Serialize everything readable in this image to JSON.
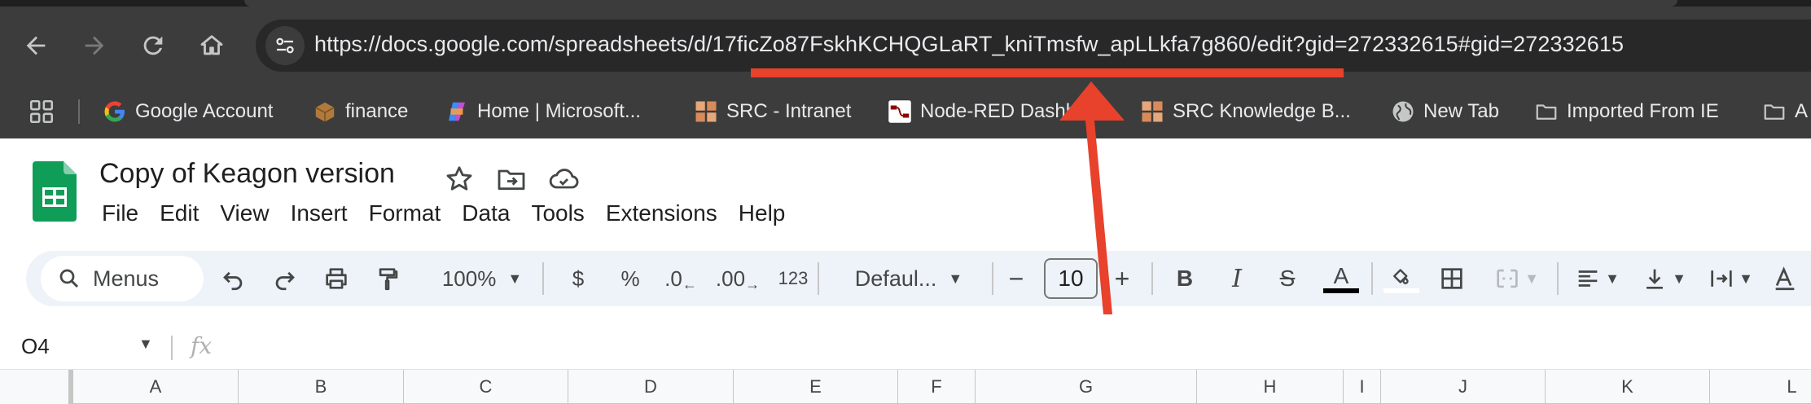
{
  "browser": {
    "url": "https://docs.google.com/spreadsheets/d/17ficZo87FskhKCHQGLaRT_kniTmsfw_apLLkfa7g860/edit?gid=272332615#gid=272332615",
    "bookmarks": [
      {
        "label": "Google Account",
        "icon": "google-g-icon"
      },
      {
        "label": "finance",
        "icon": "package-icon"
      },
      {
        "label": "Home | Microsoft...",
        "icon": "copilot-icon"
      },
      {
        "label": "SRC - Intranet",
        "icon": "grid-logo-icon"
      },
      {
        "label": "Node-RED Dashb...",
        "icon": "node-red-icon"
      },
      {
        "label": "SRC Knowledge B...",
        "icon": "grid-logo-icon"
      },
      {
        "label": "New Tab",
        "icon": "globe-icon"
      },
      {
        "label": "Imported From IE",
        "icon": "folder-icon"
      },
      {
        "label": "A",
        "icon": "folder-icon"
      }
    ]
  },
  "sheets": {
    "title": "Copy of Keagon version",
    "menus": [
      "File",
      "Edit",
      "View",
      "Insert",
      "Format",
      "Data",
      "Tools",
      "Extensions",
      "Help"
    ],
    "toolbar": {
      "search_label": "Menus",
      "zoom": "100%",
      "currency": "$",
      "percent": "%",
      "decrease_decimal": ".0",
      "increase_decimal": ".00",
      "number_format": "123",
      "font": "Defaul...",
      "minus": "−",
      "font_size": "10",
      "plus": "+",
      "bold": "B",
      "italic": "I",
      "strike": "S",
      "text_color": "A"
    },
    "name_box": "O4",
    "fx": "fx",
    "columns": [
      "A",
      "B",
      "C",
      "D",
      "E",
      "F",
      "G",
      "H",
      "I",
      "J",
      "K",
      "L"
    ]
  },
  "colors": {
    "chrome_dark": "#3c3c3c",
    "omnibox": "#282828",
    "sheets_green": "#0f9d58",
    "toolbar_bg": "#eef2f9",
    "annotation_red": "#e8412c"
  }
}
